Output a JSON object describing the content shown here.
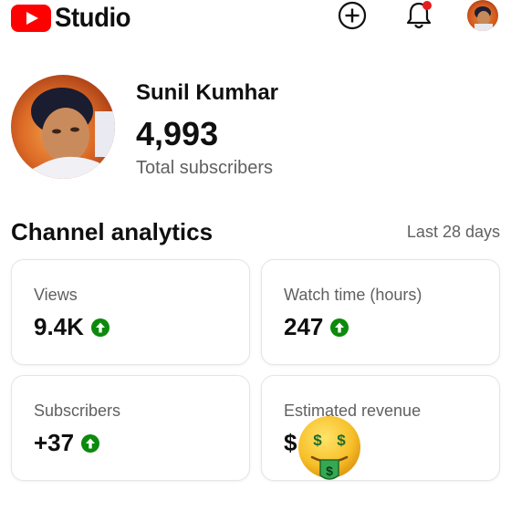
{
  "header": {
    "app_name": "Studio",
    "icons": [
      "youtube-logo-icon",
      "create-plus-icon",
      "notification-bell-icon",
      "account-avatar"
    ],
    "brand_color": "#ff0000",
    "notification_dot_color": "#e51d1d"
  },
  "channel": {
    "name": "Sunil Kumhar",
    "subscriber_count": "4,993",
    "subscriber_label": "Total subscribers"
  },
  "analytics": {
    "title": "Channel analytics",
    "range": "Last 28 days",
    "cards": [
      {
        "label": "Views",
        "value": "9.4K",
        "trend": "up"
      },
      {
        "label": "Watch time (hours)",
        "value": "247",
        "trend": "up"
      },
      {
        "label": "Subscribers",
        "value": "+37",
        "trend": "up"
      },
      {
        "label": "Estimated revenue",
        "value": "$"
      }
    ],
    "trend_up_color": "#0b8a0b"
  },
  "overlay": {
    "icon": "money-mouth-face-emoji"
  }
}
